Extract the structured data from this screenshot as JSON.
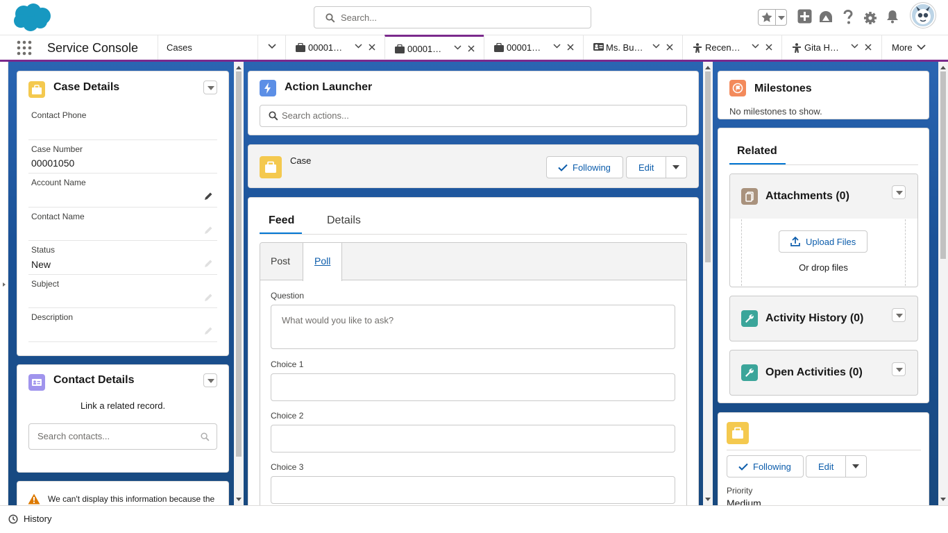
{
  "header": {
    "search_placeholder": "Search...",
    "icons": [
      "favorites-icon",
      "global-actions-icon",
      "trailhead-icon",
      "help-icon",
      "setup-icon",
      "notifications-icon"
    ]
  },
  "tabbar": {
    "app_name": "Service Console",
    "nav_item": "Cases",
    "tabs": [
      {
        "label": "00001…",
        "icon": "case-icon",
        "active": false
      },
      {
        "label": "00001…",
        "icon": "case-icon",
        "active": true
      },
      {
        "label": "00001…",
        "icon": "case-icon",
        "active": false
      },
      {
        "label": "Ms. Bu…",
        "icon": "contact-card-icon",
        "active": false
      },
      {
        "label": "Recen…",
        "icon": "person-icon",
        "active": false
      },
      {
        "label": "Gita H…",
        "icon": "person-icon",
        "active": false
      }
    ],
    "more_label": "More"
  },
  "case_details": {
    "title": "Case Details",
    "fields": [
      {
        "label": "Contact Phone",
        "value": ""
      },
      {
        "label": "Case Number",
        "value": "00001050"
      },
      {
        "label": "Account Name",
        "value": ""
      },
      {
        "label": "Contact Name",
        "value": ""
      },
      {
        "label": "Status",
        "value": "New"
      },
      {
        "label": "Subject",
        "value": ""
      },
      {
        "label": "Description",
        "value": ""
      }
    ]
  },
  "contact_details": {
    "title": "Contact Details",
    "message": "Link a related record.",
    "search_placeholder": "Search contacts..."
  },
  "warning": {
    "text": "We can't display this information because the"
  },
  "action_launcher": {
    "title": "Action Launcher",
    "search_placeholder": "Search actions..."
  },
  "case_header": {
    "label": "Case",
    "following_label": "Following",
    "edit_label": "Edit"
  },
  "feed": {
    "tabs": [
      "Feed",
      "Details"
    ],
    "publisher_tabs": [
      "Post",
      "Poll"
    ],
    "question_label": "Question",
    "question_placeholder": "What would you like to ask?",
    "choices": [
      "Choice 1",
      "Choice 2",
      "Choice 3"
    ]
  },
  "milestones": {
    "title": "Milestones",
    "message": "No milestones to show."
  },
  "related": {
    "tab": "Related",
    "attachments_title": "Attachments (0)",
    "upload_label": "Upload Files",
    "drop_label": "Or drop files",
    "activity_history_title": "Activity History (0)",
    "open_activities_title": "Open Activities (0)"
  },
  "highlights": {
    "following_label": "Following",
    "edit_label": "Edit",
    "priority_label": "Priority",
    "priority_value": "Medium"
  },
  "footer": {
    "history_label": "History"
  },
  "colors": {
    "brand_purple": "#7b2a8c",
    "link_blue": "#0b5cab",
    "case_yellow": "#f4c94f",
    "contact_purple": "#a094ed",
    "action_blue": "#5c8fe6",
    "milestone_orange": "#f38a5b",
    "attachment_tan": "#a9927d",
    "activity_teal": "#3ba59a"
  }
}
